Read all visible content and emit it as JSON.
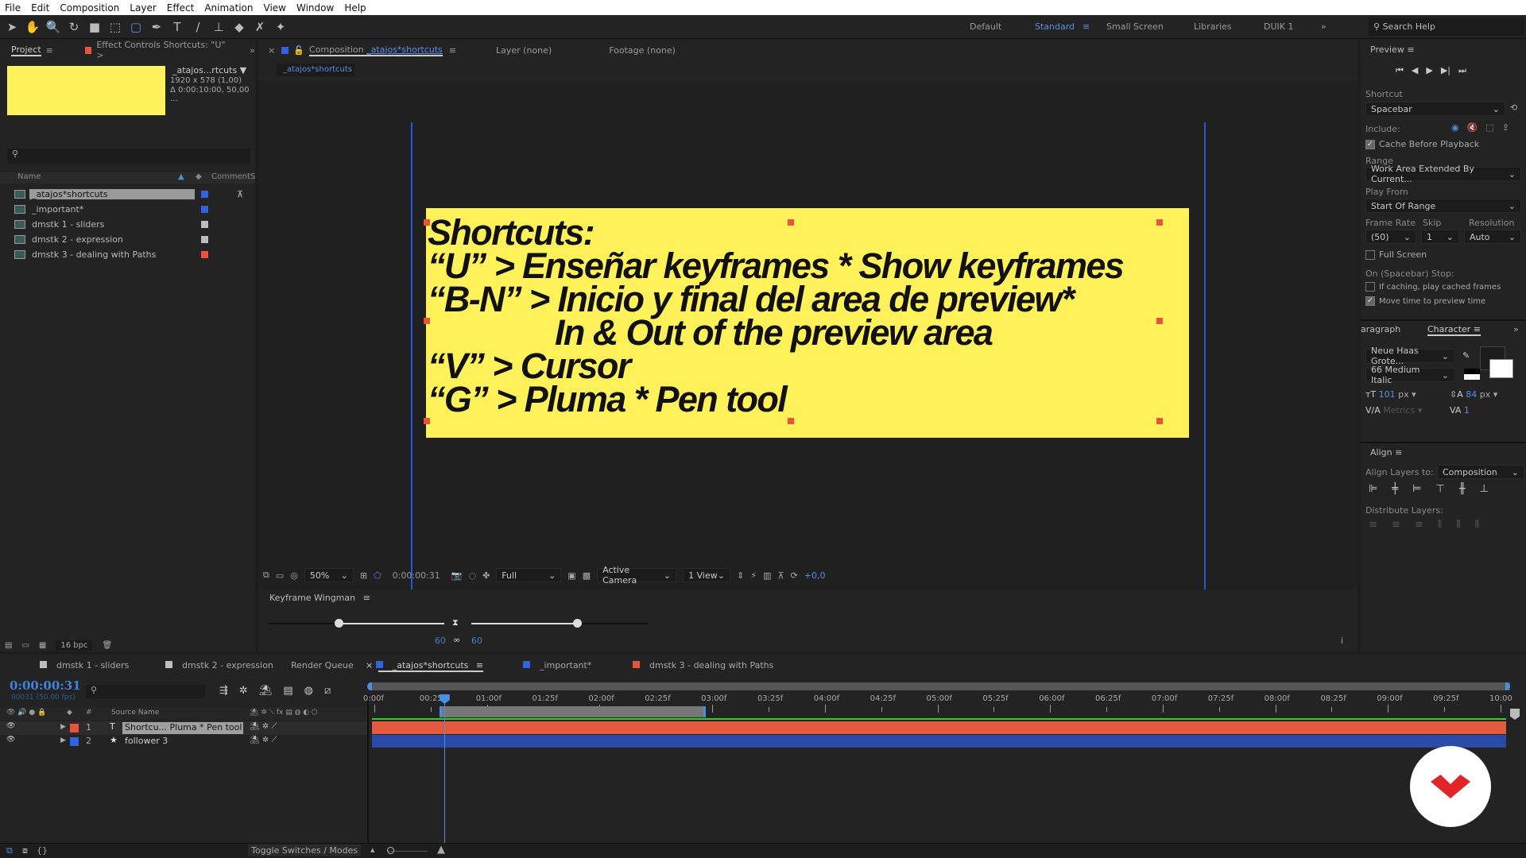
{
  "menu": [
    "File",
    "Edit",
    "Composition",
    "Layer",
    "Effect",
    "Animation",
    "View",
    "Window",
    "Help"
  ],
  "tools": [
    {
      "icon": "selection-arrow-icon",
      "g": "➤"
    },
    {
      "icon": "hand-icon",
      "g": "✋"
    },
    {
      "icon": "zoom-icon",
      "g": "🔍"
    },
    {
      "icon": "rotate-icon",
      "g": "↻"
    },
    {
      "icon": "camera-icon",
      "g": "■"
    },
    {
      "icon": "pan-behind-icon",
      "g": "⬚"
    },
    {
      "icon": "rectangle-icon",
      "g": "▢",
      "active": true
    },
    {
      "icon": "pen-icon",
      "g": "✒"
    },
    {
      "icon": "type-icon",
      "g": "T"
    },
    {
      "icon": "brush-icon",
      "g": "/"
    },
    {
      "icon": "clone-stamp-icon",
      "g": "⊥"
    },
    {
      "icon": "eraser-icon",
      "g": "◆"
    },
    {
      "icon": "roto-brush-icon",
      "g": "✗"
    },
    {
      "icon": "puppet-pin-icon",
      "g": "✦"
    }
  ],
  "workspaces": [
    "Default",
    "Standard",
    "Small Screen",
    "Libraries",
    "DUIK 1"
  ],
  "active_workspace": "Standard",
  "search_help": "Search Help",
  "project": {
    "tab": "Project",
    "effect_tab": "Effect Controls Shortcuts: \"U\" >",
    "item_name": "_atajos...rtcuts ▼",
    "item_size": "1920 x 578 (1,00)",
    "item_duration": "Δ 0:00:10:00, 50,00 ...",
    "thumb_color": "#fff15a",
    "col_name": "Name",
    "col_comment": "Comment",
    "col_s": "S",
    "bpc": "16 bpc",
    "items": [
      {
        "name": "_atajos*shortcuts",
        "color": "#2f63e0",
        "selected": true
      },
      {
        "name": "_important*",
        "color": "#2f63e0"
      },
      {
        "name": "dmstk 1 - sliders",
        "color": "#bdbdbd"
      },
      {
        "name": "dmstk 2 - expression",
        "color": "#bdbdbd"
      },
      {
        "name": "dmstk 3 - dealing with Paths",
        "color": "#e8533a"
      }
    ]
  },
  "viewer": {
    "tab": "Composition",
    "comp_name": "_atajos*shortcuts",
    "layer_tab": "Layer (none)",
    "footage_tab": "Footage (none)",
    "subtab": "_atajos*shortcuts",
    "lines": [
      "Shortcuts:",
      "“U” > Enseñar keyframes * Show keyframes",
      "“B-N” > Inicio y final del area de preview*",
      "In & Out of the preview area",
      "“V” > Cursor",
      "“G” > Pluma * Pen tool"
    ],
    "bg_color": "#fff15a",
    "zoom": "50%",
    "timecode": "0:00:00:31",
    "resolution": "Full",
    "camera": "Active Camera",
    "views": "1 View",
    "exposure": "+0,0"
  },
  "wingman": {
    "title": "Keyframe Wingman",
    "left_value": "60",
    "right_value": "60",
    "left_slider": 0.4,
    "right_slider": 0.6
  },
  "preview": {
    "title": "Preview",
    "shortcut_label": "Shortcut",
    "shortcut": "Spacebar",
    "include_label": "Include:",
    "cache": "Cache Before Playback",
    "cache_on": true,
    "range_label": "Range",
    "range": "Work Area Extended By Current...",
    "play_from_label": "Play From",
    "play_from": "Start Of Range",
    "frame_rate_label": "Frame Rate",
    "skip_label": "Skip",
    "resolution_label": "Resolution",
    "frame_rate": "(50)",
    "skip": "1",
    "resolution": "Auto",
    "full_screen": "Full Screen",
    "stop_label": "On (Spacebar) Stop:",
    "if_caching": "If caching, play cached frames",
    "move_time": "Move time to preview time"
  },
  "character": {
    "paragraph_tab": "aragraph",
    "tab": "Character",
    "font": "Neue Haas Grote...",
    "style": "66 Medium Italic",
    "size": "101",
    "size_unit": "px",
    "leading": "84",
    "leading_unit": "px",
    "kerning": "Metrics",
    "tracking": "1"
  },
  "align": {
    "title": "Align",
    "align_to_label": "Align Layers to:",
    "align_to": "Composition",
    "distribute_label": "Distribute Layers:"
  },
  "timeline": {
    "tabs": [
      {
        "name": "dmstk 1 - sliders",
        "color": "#bdbdbd"
      },
      {
        "name": "dmstk 2 - expression",
        "color": "#bdbdbd"
      },
      {
        "name": "Render Queue",
        "color": ""
      },
      {
        "name": "_atajos*shortcuts",
        "color": "#2f63e0",
        "active": true
      },
      {
        "name": "_important*",
        "color": "#2f63e0"
      },
      {
        "name": "dmstk 3 - dealing with Paths",
        "color": "#e8533a"
      }
    ],
    "timecode": "0:00:00:31",
    "fps": "00031 (50.00 fps)",
    "source_name": "Source Name",
    "hash": "#",
    "layers": [
      {
        "num": "1",
        "type": "T",
        "name": "Shortcu... Pluma * Pen tool",
        "color": "#e8533a",
        "bar": "#e35a3e",
        "selected": true
      },
      {
        "num": "2",
        "type": "★",
        "name": "follower 3",
        "color": "#2f63e0",
        "bar": "#2a4aa8"
      }
    ],
    "ruler": [
      "0:00f",
      "00:25f",
      "01:00f",
      "01:25f",
      "02:00f",
      "02:25f",
      "03:00f",
      "03:25f",
      "04:00f",
      "04:25f",
      "05:00f",
      "05:25f",
      "06:00f",
      "06:25f",
      "07:00f",
      "07:25f",
      "08:00f",
      "08:25f",
      "09:00f",
      "09:25f",
      "10:00"
    ],
    "playhead_frame": 31,
    "work_area_frames": [
      29,
      147
    ],
    "total_frames": 500,
    "toggle": "Toggle Switches / Modes"
  }
}
